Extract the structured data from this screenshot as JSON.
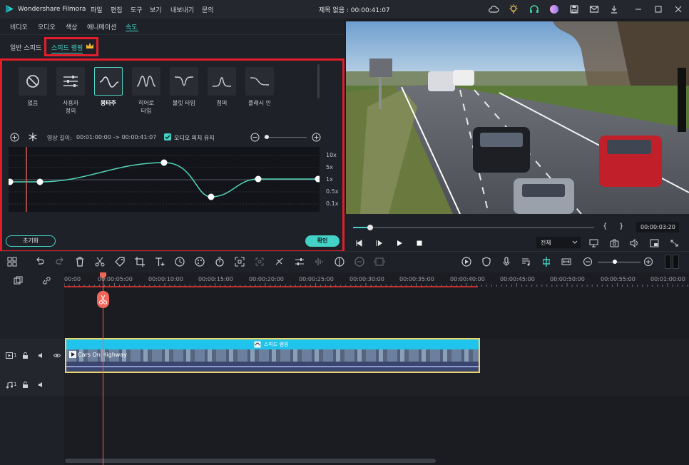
{
  "app": {
    "name": "Wondershare Filmora",
    "doc_title": "제목 없음 : 00:00:41:07"
  },
  "menu": [
    "파일",
    "편집",
    "도구",
    "보기",
    "내보내기",
    "문의"
  ],
  "tabs": [
    "비디오",
    "오디오",
    "색상",
    "애니메이션",
    "속도"
  ],
  "subtabs": [
    "일반 스피드",
    "스피드 램핑"
  ],
  "presets": [
    {
      "label": "없음"
    },
    {
      "label": "사용자\n정의"
    },
    {
      "label": "몽타주"
    },
    {
      "label": "히어로\n타임"
    },
    {
      "label": "불릿 타임"
    },
    {
      "label": "점퍼"
    },
    {
      "label": "플래시 인"
    }
  ],
  "speed": {
    "duration_label": "영상 길이:",
    "duration_value": "00:01:00:00 -> 00:00:41:07",
    "pitch_label": "오디오 피치 유지",
    "pitch_checked": true,
    "levels": [
      "10x",
      "5x",
      "1x",
      "0.5x",
      "0.1x"
    ],
    "reset": "초기화",
    "ok": "확인"
  },
  "player": {
    "time": "00:00:03:20",
    "brackets": [
      "{",
      "}"
    ],
    "quality": "전체",
    "progress_pct": 7
  },
  "timeline": {
    "ruler": [
      "00:00",
      "00:00:05:00",
      "00:00:10:00",
      "00:00:15:00",
      "00:00:20:00",
      "00:00:25:00",
      "00:00:30:00",
      "00:00:35:00",
      "00:00:40:00",
      "00:00:45:00",
      "00:00:50:00",
      "00:00:55:00",
      "00:01:00:00"
    ],
    "clip_badge": "스피드 램핑",
    "clip_name": "Cars On Highway",
    "video_track": "1",
    "audio_track": "1"
  },
  "colors": {
    "accent": "#44d2c6",
    "highlight": "#e31e2a",
    "playhead": "#f0675a",
    "clip_bar": "#1fc3ec"
  }
}
